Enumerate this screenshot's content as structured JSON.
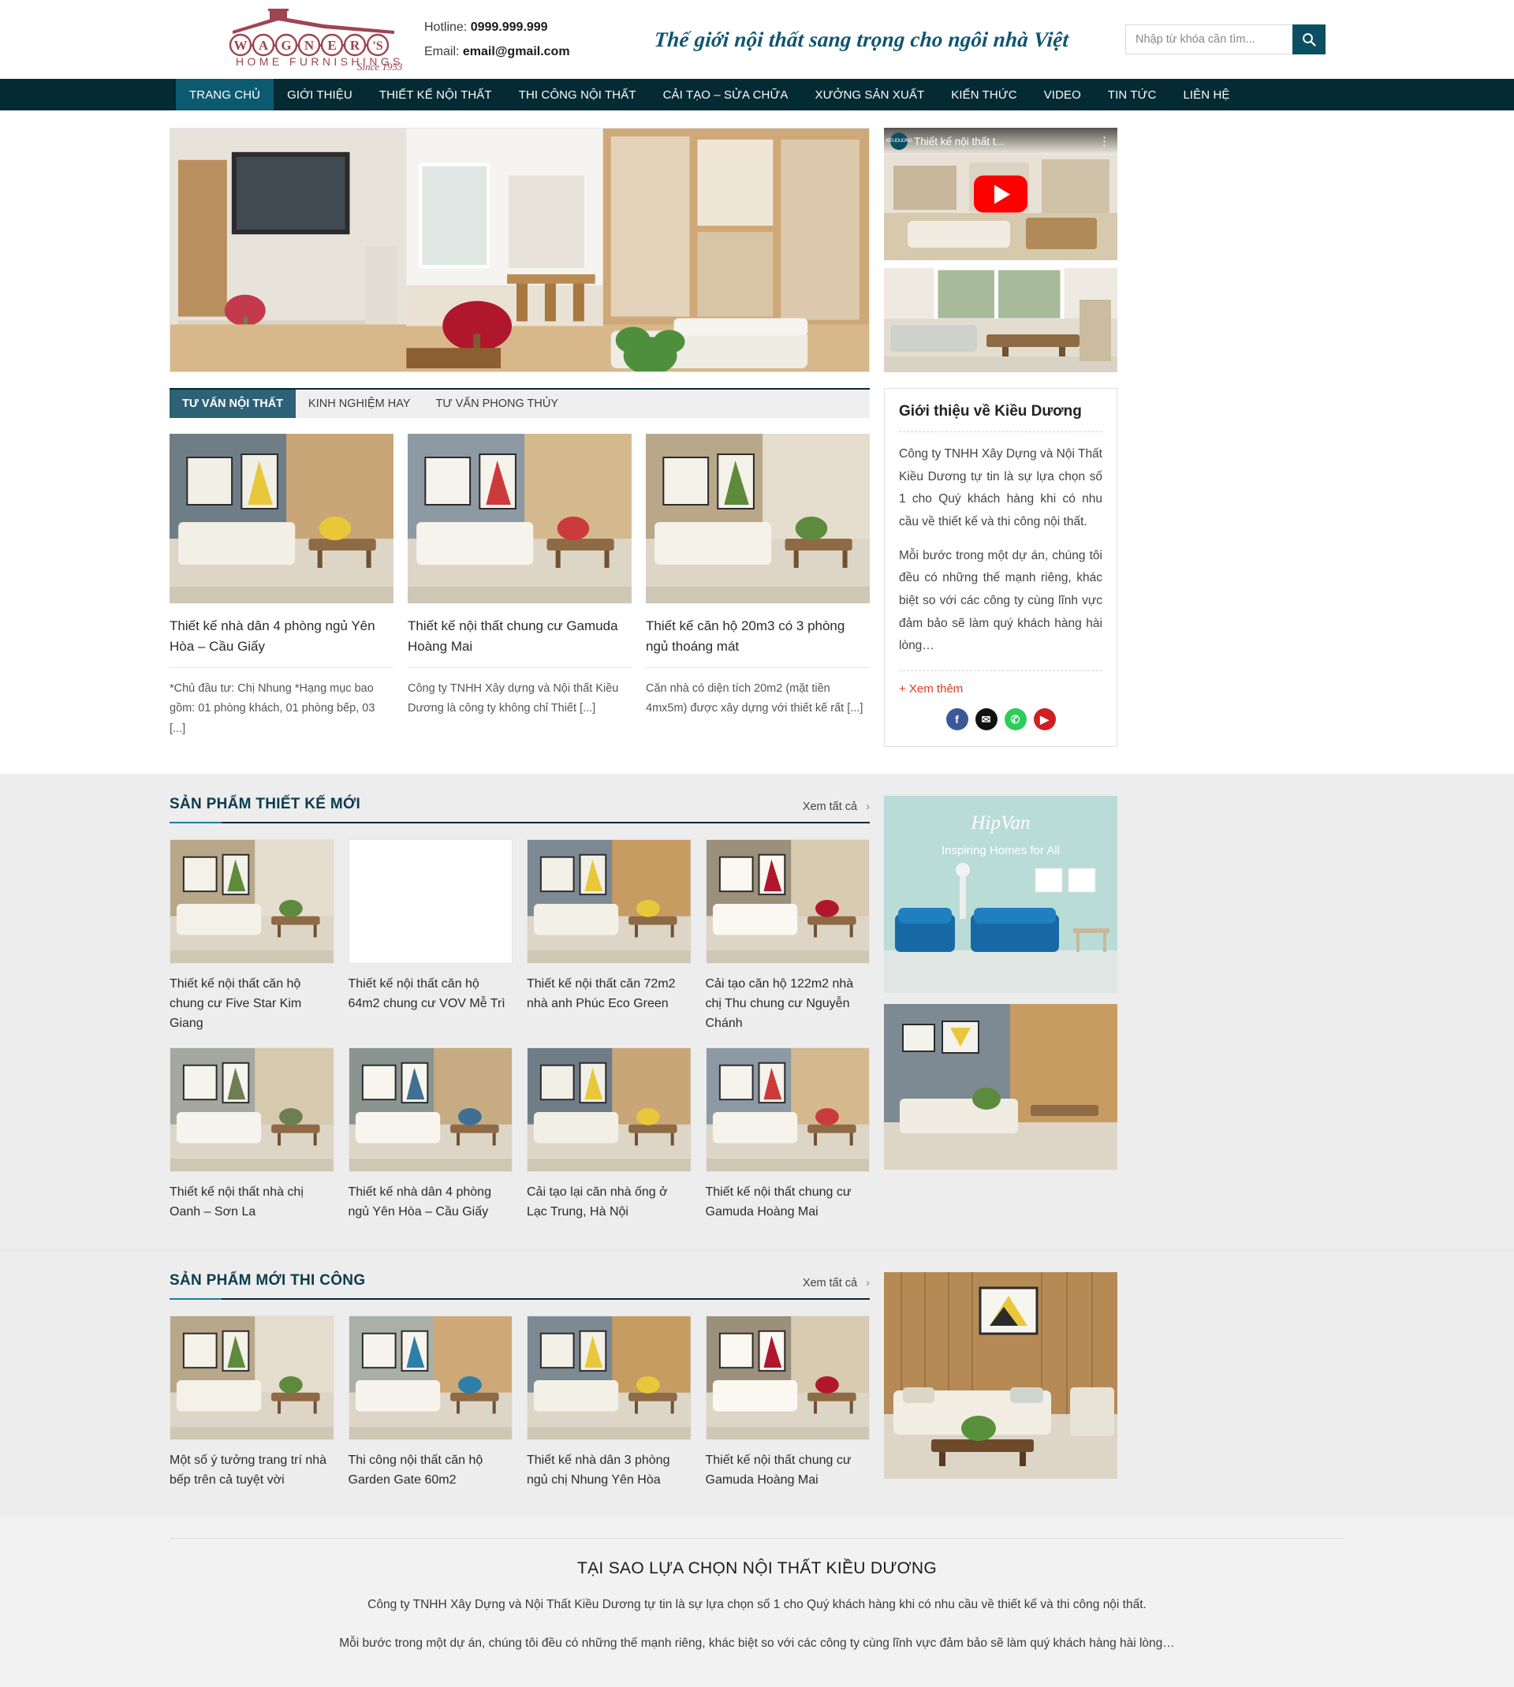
{
  "header": {
    "logo": {
      "brand": "WAGNER'S",
      "sub": "HOME FURNISHINGS",
      "since": "Since 1953"
    },
    "hotline_label": "Hotline:",
    "hotline_value": "0999.999.999",
    "email_label": "Email:",
    "email_value": "email@gmail.com",
    "slogan": "Thế giới nội thất sang trọng cho ngôi nhà Việt",
    "search": {
      "placeholder": "Nhập từ khóa cần tìm...",
      "value": "",
      "icon": "search-icon"
    }
  },
  "nav": {
    "items": [
      {
        "label": "TRANG CHỦ",
        "active": true
      },
      {
        "label": "GIỚI THIỆU",
        "active": false
      },
      {
        "label": "THIẾT KẾ NỘI THẤT",
        "active": false
      },
      {
        "label": "THI CÔNG NỘI THẤT",
        "active": false
      },
      {
        "label": "CẢI TẠO – SỬA CHỮA",
        "active": false
      },
      {
        "label": "XƯỞNG SẢN XUẤT",
        "active": false
      },
      {
        "label": "KIẾN THỨC",
        "active": false
      },
      {
        "label": "VIDEO",
        "active": false
      },
      {
        "label": "TIN TỨC",
        "active": false
      },
      {
        "label": "LIÊN HỆ",
        "active": false
      }
    ]
  },
  "hero": {
    "main_alt": "Phòng khách hiện đại với kệ tivi gỗ và sofa trắng",
    "video": {
      "channel": "KIEUDUONG",
      "title": "Thiết kế nội thất t...",
      "menu_icon": "kebab-menu-icon",
      "play_icon": "play-icon"
    },
    "side_alt": "Phòng khách sáng với sofa xám và bàn gỗ"
  },
  "tabs": {
    "items": [
      {
        "label": "TƯ VẤN NỘI THẤT",
        "active": true
      },
      {
        "label": "KINH NGHIỆM HAY",
        "active": false
      },
      {
        "label": "TƯ VẤN PHONG THỦY",
        "active": false
      }
    ]
  },
  "articles": [
    {
      "title": "Thiết kế nhà dân 4 phòng ngủ Yên Hòa – Cầu Giấy",
      "excerpt": "*Chủ đầu tư: Chị Nhung *Hạng mục bao gồm: 01 phòng khách, 01 phòng bếp, 03 [...]"
    },
    {
      "title": "Thiết kế nội thất chung cư Gamuda Hoàng Mai",
      "excerpt": "Công ty TNHH Xây dựng và Nội thất Kiều Dương là công ty không chỉ Thiết [...]"
    },
    {
      "title": "Thiết kế căn hộ 20m3 có 3 phòng ngủ thoáng mát",
      "excerpt": "Căn nhà có diện tích 20m2 (mặt tiền 4mx5m) được xây dựng với thiết kế rất [...]"
    }
  ],
  "about_box": {
    "title": "Giới thiệu về Kiều Dương",
    "p1": "Công ty TNHH Xây Dựng và Nội Thất Kiều Dương tự tin là sự lựa chọn số 1 cho Quý khách hàng khi có nhu cầu về thiết kế và thi công nội thất.",
    "p2": "Mỗi bước trong một dự án, chúng tôi đều có những thế mạnh riêng, khác biệt so với các công ty cùng lĩnh vực đảm bảo sẽ làm quý khách hàng hài lòng…",
    "more": "+ Xem thêm",
    "socials": [
      {
        "name": "facebook-icon",
        "glyph": "f",
        "color": "#3b5998"
      },
      {
        "name": "email-icon",
        "glyph": "✉",
        "color": "#111111"
      },
      {
        "name": "phone-icon",
        "glyph": "✆",
        "color": "#2ecc5a"
      },
      {
        "name": "youtube-icon",
        "glyph": "▶",
        "color": "#cc2025"
      }
    ]
  },
  "section_design": {
    "title": "SẢN PHẨM THIẾT KẾ MỚI",
    "viewall": "Xem tất cả",
    "chevron": "›",
    "cards": [
      {
        "title": "Thiết kế nội thất căn hộ chung cư Five Star Kim Giang",
        "blank": false
      },
      {
        "title": "Thiết kế nội thất căn hộ 64m2 chung cư VOV Mễ Trì",
        "blank": true
      },
      {
        "title": "Thiết kế nội thất căn 72m2 nhà anh Phúc Eco Green",
        "blank": false
      },
      {
        "title": "Cải tạo căn hộ 122m2 nhà chị Thu chung cư Nguyễn Chánh",
        "blank": false
      },
      {
        "title": "Thiết kế nội thất nhà chị Oanh – Sơn La",
        "blank": false
      },
      {
        "title": "Thiết kế nhà dân 4 phòng ngủ Yên Hòa – Cầu Giấy",
        "blank": false
      },
      {
        "title": "Cải tạo lại căn nhà ống ở Lạc Trung, Hà Nội",
        "blank": false
      },
      {
        "title": "Thiết kế nội thất chung cư Gamuda Hoàng Mai",
        "blank": false
      }
    ],
    "banner": {
      "brand": "HipVan",
      "tagline": "Inspiring Homes for All"
    }
  },
  "section_build": {
    "title": "SẢN PHẨM MỚI THI CÔNG",
    "viewall": "Xem tất cả",
    "chevron": "›",
    "cards": [
      {
        "title": "Một số ý tưởng trang trí nhà bếp trên cả tuyệt vời"
      },
      {
        "title": "Thi công nội thất căn hộ Garden Gate 60m2"
      },
      {
        "title": "Thiết kế nhà dân 3 phòng ngủ chị Nhung Yên Hòa"
      },
      {
        "title": "Thiết kế nội thất chung cư Gamuda Hoàng Mai"
      }
    ]
  },
  "why": {
    "title": "TẠI SAO LỰA CHỌN NỘI THẤT KIỀU DƯƠNG",
    "p1": "Công ty TNHH Xây Dựng và Nội Thất Kiều Dương tự tin là sự lựa chọn số 1 cho Quý khách hàng khi có nhu cầu về thiết kế và thi công nội thất.",
    "p2": "Mỗi bước trong một dự án, chúng tôi đều có những thế mạnh riêng, khác biệt so với các công ty cùng lĩnh vực đảm bảo sẽ làm quý khách hàng hài lòng…"
  },
  "colors": {
    "nav_bg": "#042a33",
    "nav_active": "#0c5a70",
    "accent": "#1d7e9e",
    "slogan": "#0e5571",
    "link_red": "#e03a1f",
    "section_bg": "#ededed"
  }
}
